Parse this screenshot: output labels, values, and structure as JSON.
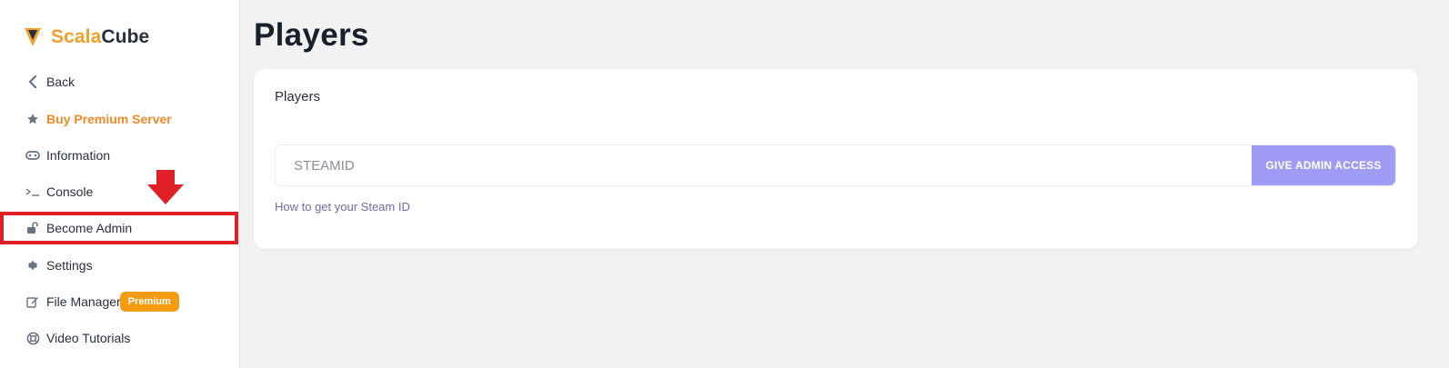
{
  "brand": {
    "name_part1": "Scala",
    "name_part2": "Cube",
    "accent": "#f0a02a"
  },
  "sidebar": {
    "items": [
      {
        "label": "Back",
        "icon": "chevron-left-icon"
      },
      {
        "label": "Buy Premium Server",
        "icon": "star-icon",
        "color": "#f08a2a"
      },
      {
        "label": "Information",
        "icon": "gamepad-icon"
      },
      {
        "label": "Console",
        "icon": "terminal-icon"
      },
      {
        "label": "Become Admin",
        "icon": "unlock-icon",
        "highlighted": true
      },
      {
        "label": "Settings",
        "icon": "gear-icon"
      },
      {
        "label": "File Manager",
        "icon": "edit-icon",
        "badge": "Premium"
      },
      {
        "label": "Video Tutorials",
        "icon": "life-ring-icon"
      }
    ],
    "highlight_color": "#e01f26",
    "badge_color": "#f59b0f"
  },
  "page": {
    "title": "Players"
  },
  "card": {
    "title": "Players",
    "input_placeholder": "STEAMID",
    "button_label": "GIVE ADMIN ACCESS",
    "button_color": "#a09cf5",
    "help_link": "How to get your Steam ID"
  }
}
